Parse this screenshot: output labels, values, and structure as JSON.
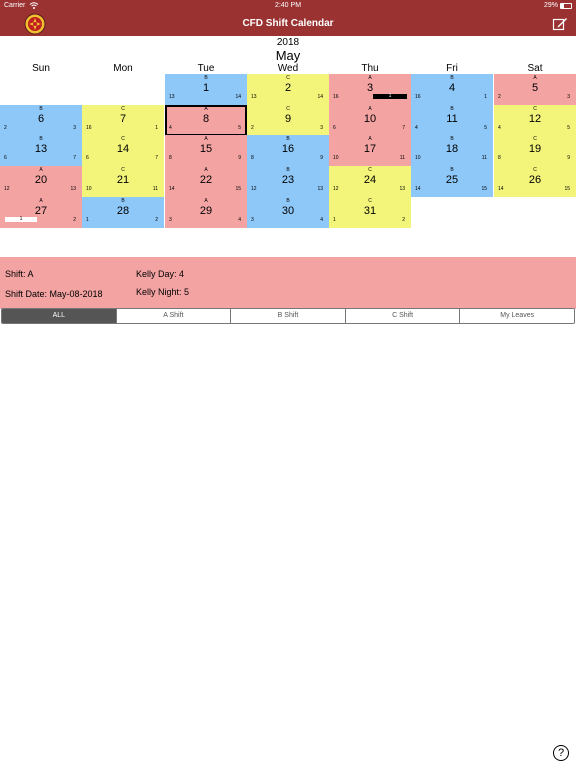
{
  "status_bar": {
    "carrier": "Carrier",
    "time": "2:40 PM",
    "battery": "29%"
  },
  "nav": {
    "title": "CFD Shift Calendar",
    "logo_icon": "fire-department-badge-icon",
    "edit_icon": "compose-edit-icon"
  },
  "calendar": {
    "year": "2018",
    "month": "May",
    "weekdays": [
      "Sun",
      "Mon",
      "Tue",
      "Wed",
      "Thu",
      "Fri",
      "Sat"
    ],
    "colors": {
      "A": "#f4a3a3",
      "B": "#8ec8f8",
      "C": "#f2f57a"
    },
    "days": [
      {
        "day": "1",
        "shift": "B",
        "kl": "13",
        "kr": "14"
      },
      {
        "day": "2",
        "shift": "C",
        "kl": "13",
        "kr": "14"
      },
      {
        "day": "3",
        "shift": "A",
        "kl": "16",
        "kr": "",
        "leave": "1",
        "leave_style": "dark"
      },
      {
        "day": "4",
        "shift": "B",
        "kl": "16",
        "kr": "1"
      },
      {
        "day": "5",
        "shift": "A",
        "kl": "2",
        "kr": "3"
      },
      {
        "day": "6",
        "shift": "B",
        "kl": "2",
        "kr": "3"
      },
      {
        "day": "7",
        "shift": "C",
        "kl": "16",
        "kr": "1"
      },
      {
        "day": "8",
        "shift": "A",
        "kl": "4",
        "kr": "5",
        "selected": true
      },
      {
        "day": "9",
        "shift": "C",
        "kl": "2",
        "kr": "3"
      },
      {
        "day": "10",
        "shift": "A",
        "kl": "6",
        "kr": "7"
      },
      {
        "day": "11",
        "shift": "B",
        "kl": "4",
        "kr": "5"
      },
      {
        "day": "12",
        "shift": "C",
        "kl": "4",
        "kr": "5"
      },
      {
        "day": "13",
        "shift": "B",
        "kl": "6",
        "kr": "7"
      },
      {
        "day": "14",
        "shift": "C",
        "kl": "6",
        "kr": "7"
      },
      {
        "day": "15",
        "shift": "A",
        "kl": "8",
        "kr": "9"
      },
      {
        "day": "16",
        "shift": "B",
        "kl": "8",
        "kr": "9"
      },
      {
        "day": "17",
        "shift": "A",
        "kl": "10",
        "kr": "11"
      },
      {
        "day": "18",
        "shift": "B",
        "kl": "10",
        "kr": "11"
      },
      {
        "day": "19",
        "shift": "C",
        "kl": "8",
        "kr": "9"
      },
      {
        "day": "20",
        "shift": "A",
        "kl": "12",
        "kr": "13"
      },
      {
        "day": "21",
        "shift": "C",
        "kl": "10",
        "kr": "11"
      },
      {
        "day": "22",
        "shift": "A",
        "kl": "14",
        "kr": "15"
      },
      {
        "day": "23",
        "shift": "B",
        "kl": "12",
        "kr": "13"
      },
      {
        "day": "24",
        "shift": "C",
        "kl": "12",
        "kr": "13"
      },
      {
        "day": "25",
        "shift": "B",
        "kl": "14",
        "kr": "15"
      },
      {
        "day": "26",
        "shift": "C",
        "kl": "14",
        "kr": "15"
      },
      {
        "day": "27",
        "shift": "A",
        "kl": "",
        "kr": "2",
        "leave": "1",
        "leave_style": "light"
      },
      {
        "day": "28",
        "shift": "B",
        "kl": "1",
        "kr": "2"
      },
      {
        "day": "29",
        "shift": "A",
        "kl": "3",
        "kr": "4"
      },
      {
        "day": "30",
        "shift": "B",
        "kl": "3",
        "kr": "4"
      },
      {
        "day": "31",
        "shift": "C",
        "kl": "1",
        "kr": "2"
      }
    ]
  },
  "info": {
    "shift": "Shift: A",
    "shift_date": "Shift Date: May-08-2018",
    "kelly_day": "Kelly Day: 4",
    "kelly_night": "Kelly Night: 5"
  },
  "segments": [
    {
      "label": "ALL",
      "active": true
    },
    {
      "label": "A Shift",
      "active": false
    },
    {
      "label": "B Shift",
      "active": false
    },
    {
      "label": "C Shift",
      "active": false
    },
    {
      "label": "My Leaves",
      "active": false
    }
  ],
  "help": {
    "label": "?",
    "icon": "help-icon"
  }
}
